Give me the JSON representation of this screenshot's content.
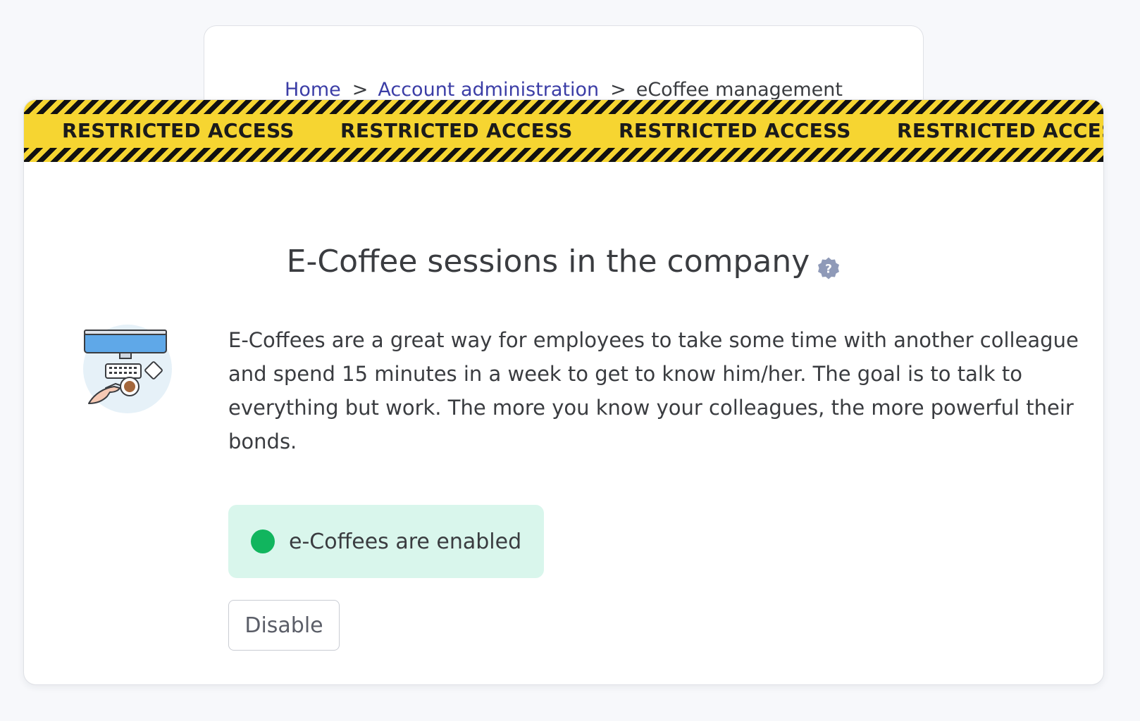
{
  "breadcrumb": {
    "items": [
      {
        "label": "Home"
      },
      {
        "label": "Account administration"
      }
    ],
    "separator": ">",
    "current": "eCoffee management"
  },
  "banner": {
    "text": "RESTRICTED ACCESS",
    "colors": {
      "tape": "#f6d531",
      "stripe": "#111111"
    }
  },
  "page": {
    "title": "E-Coffee sessions in the company",
    "help_icon": "question-badge-icon",
    "illustration": "desk-computer-coffee-illustration",
    "description": "E-Coffees are a great way for employees to take some time with another colleague and spend 15 minutes in a week to get to know him/her. The goal is to talk to everything but work. The more you know your colleagues, the more powerful their bonds."
  },
  "status": {
    "label": "e-Coffees are enabled",
    "color": "#11b55e",
    "background": "#d9f6ec"
  },
  "actions": {
    "disable_label": "Disable"
  }
}
